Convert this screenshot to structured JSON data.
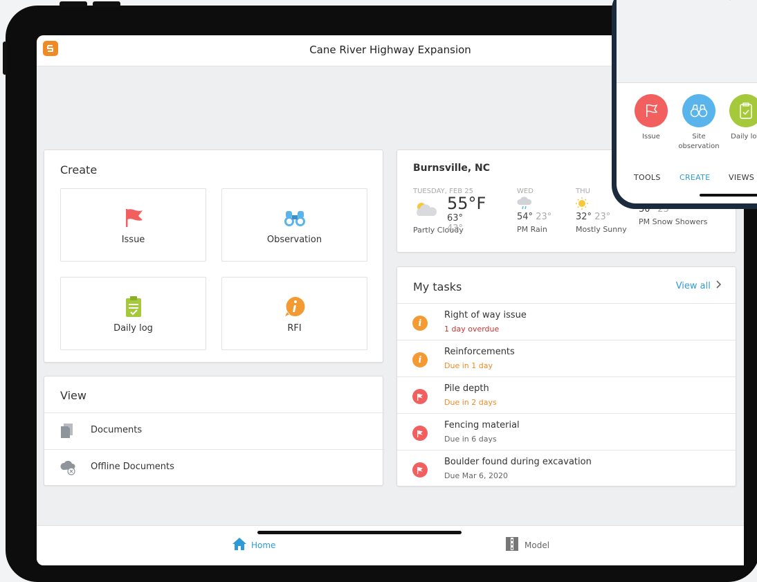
{
  "app": {
    "title": "Cane River Highway Expansion"
  },
  "create": {
    "title": "Create",
    "tiles": [
      {
        "label": "Issue",
        "icon": "flag-icon"
      },
      {
        "label": "Observation",
        "icon": "binoculars-icon"
      },
      {
        "label": "Daily log",
        "icon": "clipboard-icon"
      },
      {
        "label": "RFI",
        "icon": "info-bubble-icon"
      }
    ]
  },
  "view": {
    "title": "View",
    "items": [
      {
        "label": "Documents",
        "icon": "document-icon"
      },
      {
        "label": "Offline Documents",
        "icon": "cloud-offline-icon"
      }
    ]
  },
  "weather": {
    "location": "Burnsville, NC",
    "today": {
      "day": "TUESDAY, FEB 25",
      "temp": "55°F",
      "high": "63°",
      "low": "43°",
      "condition": "Partly Cloudy"
    },
    "forecast": [
      {
        "day": "WED",
        "high": "54°",
        "low": "23°",
        "condition": "PM Rain",
        "icon": "rain-icon"
      },
      {
        "day": "THU",
        "high": "32°",
        "low": "23°",
        "condition": "Mostly Sunny",
        "icon": "sun-icon"
      },
      {
        "day": "",
        "high": "30°",
        "low": "23°",
        "condition": "PM Snow Showers",
        "icon": "snow-icon"
      }
    ]
  },
  "tasks": {
    "title": "My tasks",
    "view_all": "View all",
    "items": [
      {
        "title": "Right of way issue",
        "due": "1 day overdue",
        "type": "rfi",
        "status": "overdue"
      },
      {
        "title": "Reinforcements",
        "due": "Due in 1 day",
        "type": "rfi",
        "status": "soon"
      },
      {
        "title": "Pile depth",
        "due": "Due in 2 days",
        "type": "issue",
        "status": "soon"
      },
      {
        "title": "Fencing material",
        "due": "Due in 6 days",
        "type": "issue",
        "status": "normal"
      },
      {
        "title": "Boulder found during excavation",
        "due": "Due Mar 6, 2020",
        "type": "issue",
        "status": "normal"
      }
    ]
  },
  "bottom_nav": {
    "tabs": [
      {
        "label": "Home",
        "icon": "home-icon",
        "active": true
      },
      {
        "label": "Model",
        "icon": "model-icon",
        "active": false
      }
    ]
  },
  "phone": {
    "create_items": [
      {
        "label": "Issue",
        "icon": "flag-icon",
        "color": "#f15f5f"
      },
      {
        "label": "Site observation",
        "icon": "binoculars-icon",
        "color": "#5ab4ec"
      },
      {
        "label": "Daily log",
        "icon": "clipboard-icon",
        "color": "#a5c93a"
      }
    ],
    "tabs": [
      {
        "label": "TOOLS",
        "active": false
      },
      {
        "label": "CREATE",
        "active": true
      },
      {
        "label": "VIEWS",
        "active": false
      }
    ]
  },
  "colors": {
    "accent": "#2e9bd6",
    "issue_red": "#f15f5f",
    "rfi_orange": "#f39a32",
    "daily_green": "#a5c93a",
    "overdue_red": "#d0312d",
    "soon_orange": "#f08a24"
  }
}
